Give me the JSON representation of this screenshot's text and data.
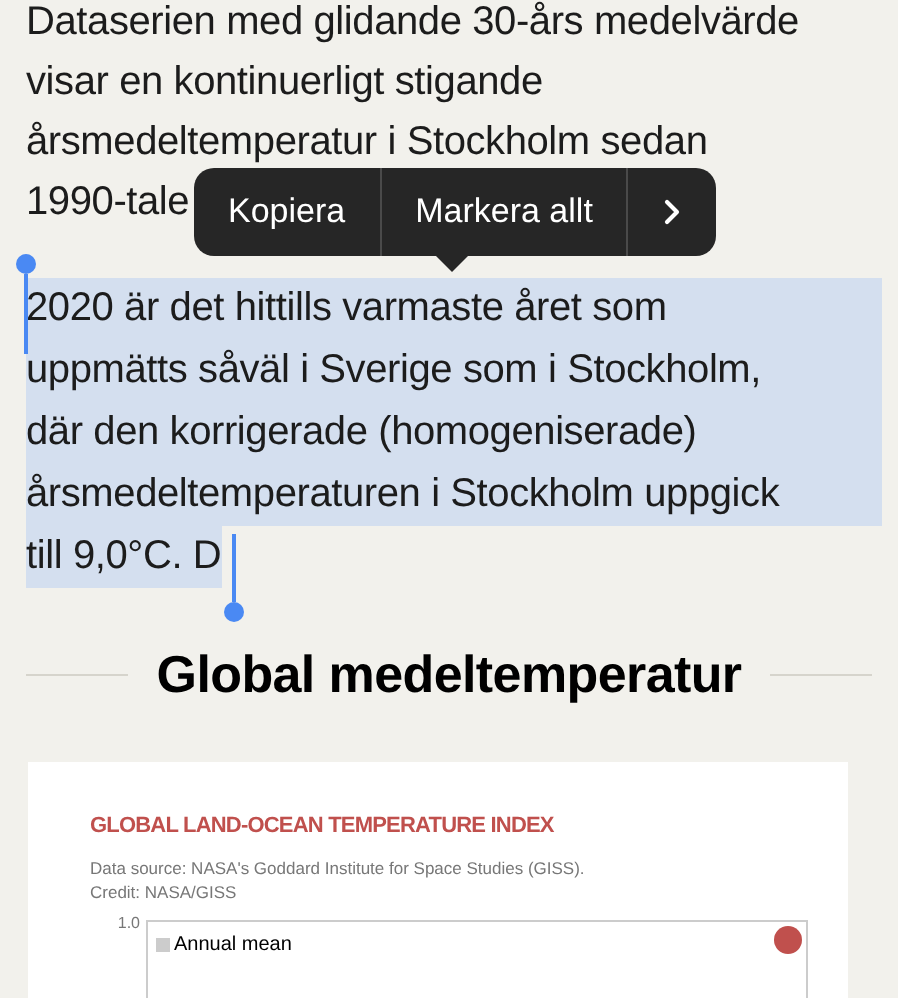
{
  "paragraphs": [
    {
      "lines": [
        "Dataserien med glidande 30-års medelvärde",
        "visar en kontinuerligt stigande",
        "årsmedeltemperatur i Stockholm sedan",
        "1990-tale"
      ],
      "selected": false
    },
    {
      "lines": [
        "2020 är det hittills varmaste året som",
        "uppmätts såväl i Sverige som i Stockholm,",
        "där den korrigerade (homogeniserade)",
        "årsmedeltemperaturen i Stockholm uppgick",
        "till 9,0°C. D"
      ],
      "selected": true
    }
  ],
  "context_menu": {
    "items": [
      "Kopiera",
      "Markera allt"
    ]
  },
  "heading": "Global medeltemperatur",
  "figure": {
    "title": "GLOBAL LAND-OCEAN TEMPERATURE INDEX",
    "source_lines": [
      "Data source: NASA's Goddard Institute for Space Studies (GISS).",
      "Credit: NASA/GISS"
    ],
    "y_tick": "1.0",
    "legend": "Annual mean"
  }
}
